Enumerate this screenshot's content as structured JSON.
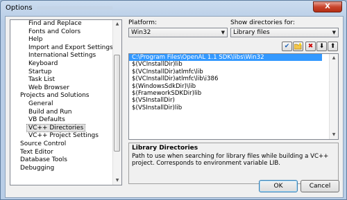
{
  "window": {
    "title": "Options",
    "close_glyph": "X"
  },
  "tree": {
    "items": [
      {
        "label": "Find and Replace",
        "level": 1
      },
      {
        "label": "Fonts and Colors",
        "level": 1
      },
      {
        "label": "Help",
        "level": 1
      },
      {
        "label": "Import and Export Settings",
        "level": 1
      },
      {
        "label": "International Settings",
        "level": 1
      },
      {
        "label": "Keyboard",
        "level": 1
      },
      {
        "label": "Startup",
        "level": 1
      },
      {
        "label": "Task List",
        "level": 1
      },
      {
        "label": "Web Browser",
        "level": 1
      },
      {
        "label": "Projects and Solutions",
        "level": 0
      },
      {
        "label": "General",
        "level": 1
      },
      {
        "label": "Build and Run",
        "level": 1
      },
      {
        "label": "VB Defaults",
        "level": 1
      },
      {
        "label": "VC++ Directories",
        "level": 1,
        "selected": true
      },
      {
        "label": "VC++ Project Settings",
        "level": 1
      },
      {
        "label": "Source Control",
        "level": 0
      },
      {
        "label": "Text Editor",
        "level": 0
      },
      {
        "label": "Database Tools",
        "level": 0
      },
      {
        "label": "Debugging",
        "level": 0
      }
    ]
  },
  "platform": {
    "label": "Platform:",
    "value": "Win32"
  },
  "show_dirs": {
    "label": "Show directories for:",
    "value": "Library files"
  },
  "directories": [
    "C:\\Program Files\\OpenAL 1.1 SDK\\libs\\Win32",
    "$(VCInstallDir)lib",
    "$(VCInstallDir)atlmfc\\lib",
    "$(VCInstallDir)atlmfc\\lib\\i386",
    "$(WindowsSdkDir)\\lib",
    "$(FrameworkSDKDir)lib",
    "$(VSInstallDir)",
    "$(VSInstallDir)lib"
  ],
  "description": {
    "heading": "Library Directories",
    "text": "Path to use when searching for library files while building a VC++ project. Corresponds to environment variable LIB."
  },
  "buttons": {
    "ok": "OK",
    "cancel": "Cancel"
  }
}
